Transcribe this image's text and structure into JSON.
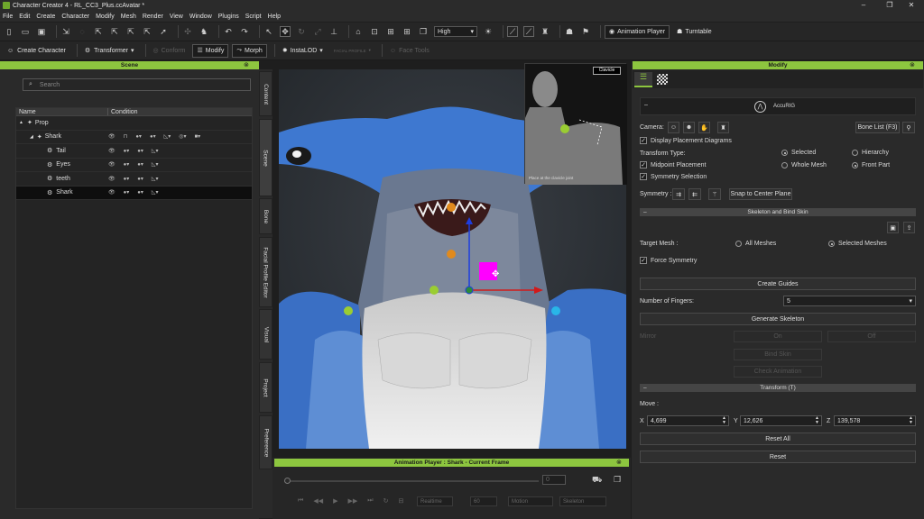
{
  "app": {
    "title": "Character Creator 4 - RL_CC3_Plus.ccAvatar *"
  },
  "window_controls": {
    "minimize": "–",
    "maximize": "❐",
    "close": "✕"
  },
  "menu": [
    "File",
    "Edit",
    "Create",
    "Character",
    "Modify",
    "Mesh",
    "Render",
    "View",
    "Window",
    "Plugins",
    "Script",
    "Help"
  ],
  "toolbar1": {
    "quality": "High",
    "animation_player": "Animation Player",
    "turntable": "Turntable"
  },
  "toolbar2": {
    "create_character": "Create Character",
    "transformer": "Transformer",
    "conform": "Conform",
    "modify": "Modify",
    "morph": "Morph",
    "instalod": "InstaLOD",
    "facial_profile": "FACIAL PROFILE",
    "face_tools": "Face Tools"
  },
  "scene": {
    "header": "Scene",
    "search_placeholder": "Search",
    "columns": [
      "Name",
      "Condition"
    ],
    "rows": [
      {
        "name": "Prop",
        "indent": 0,
        "arrow": "▲"
      },
      {
        "name": "Shark",
        "indent": 1,
        "arrow": "◢"
      },
      {
        "name": "Tail",
        "indent": 2,
        "arrow": ""
      },
      {
        "name": "Eyes",
        "indent": 2,
        "arrow": ""
      },
      {
        "name": "teeth",
        "indent": 2,
        "arrow": ""
      },
      {
        "name": "Shark",
        "indent": 2,
        "arrow": "",
        "selected": true
      }
    ]
  },
  "side_tabs": [
    "Content",
    "Scene",
    "Bone",
    "Facial Profile Editor",
    "Visual",
    "Project",
    "Preference"
  ],
  "viewport": {
    "inset_label": "Clavicle",
    "inset_caption": "Place at the clavicle joint"
  },
  "animation_player": {
    "header": "Animation Player : Shark - Current Frame",
    "frame": "0",
    "realtime": "Realtime",
    "fps": "60",
    "motion": "Motion",
    "skeleton": "Skeleton"
  },
  "modify": {
    "header": "Modify",
    "accurig": "AccuRIG",
    "camera_label": "Camera:",
    "bone_list": "Bone List (F3)",
    "display_diagrams": "Display Placement Diagrams",
    "transform_type": "Transform Type:",
    "selected": "Selected",
    "hierarchy": "Hierarchy",
    "midpoint": "Midpoint Placement",
    "whole_mesh": "Whole Mesh",
    "front_part": "Front Part",
    "symmetry_selection": "Symmetry Selection",
    "symmetry_label": "Symmetry :",
    "snap_center": "Snap to Center Plane",
    "skeleton_section": "Skeleton and Bind Skin",
    "target_mesh": "Target Mesh :",
    "all_meshes": "All Meshes",
    "selected_meshes": "Selected Meshes",
    "force_symmetry": "Force Symmetry",
    "create_guides": "Create Guides",
    "num_fingers_label": "Number of Fingers:",
    "num_fingers": "5",
    "generate_skeleton": "Generate Skeleton",
    "mirror": "Mirror",
    "on": "On",
    "off": "Off",
    "bind_skin": "Bind Skin",
    "check_animation": "Check Animation",
    "transform_section": "Transform (T)",
    "move_label": "Move :",
    "x_label": "X",
    "x": "4,699",
    "y_label": "Y",
    "y": "12,626",
    "z_label": "Z",
    "z": "139,578",
    "reset_all": "Reset All",
    "reset": "Reset"
  },
  "colors": {
    "accent": "#8dc63f",
    "gizmo_magenta": "#ff00ff"
  }
}
